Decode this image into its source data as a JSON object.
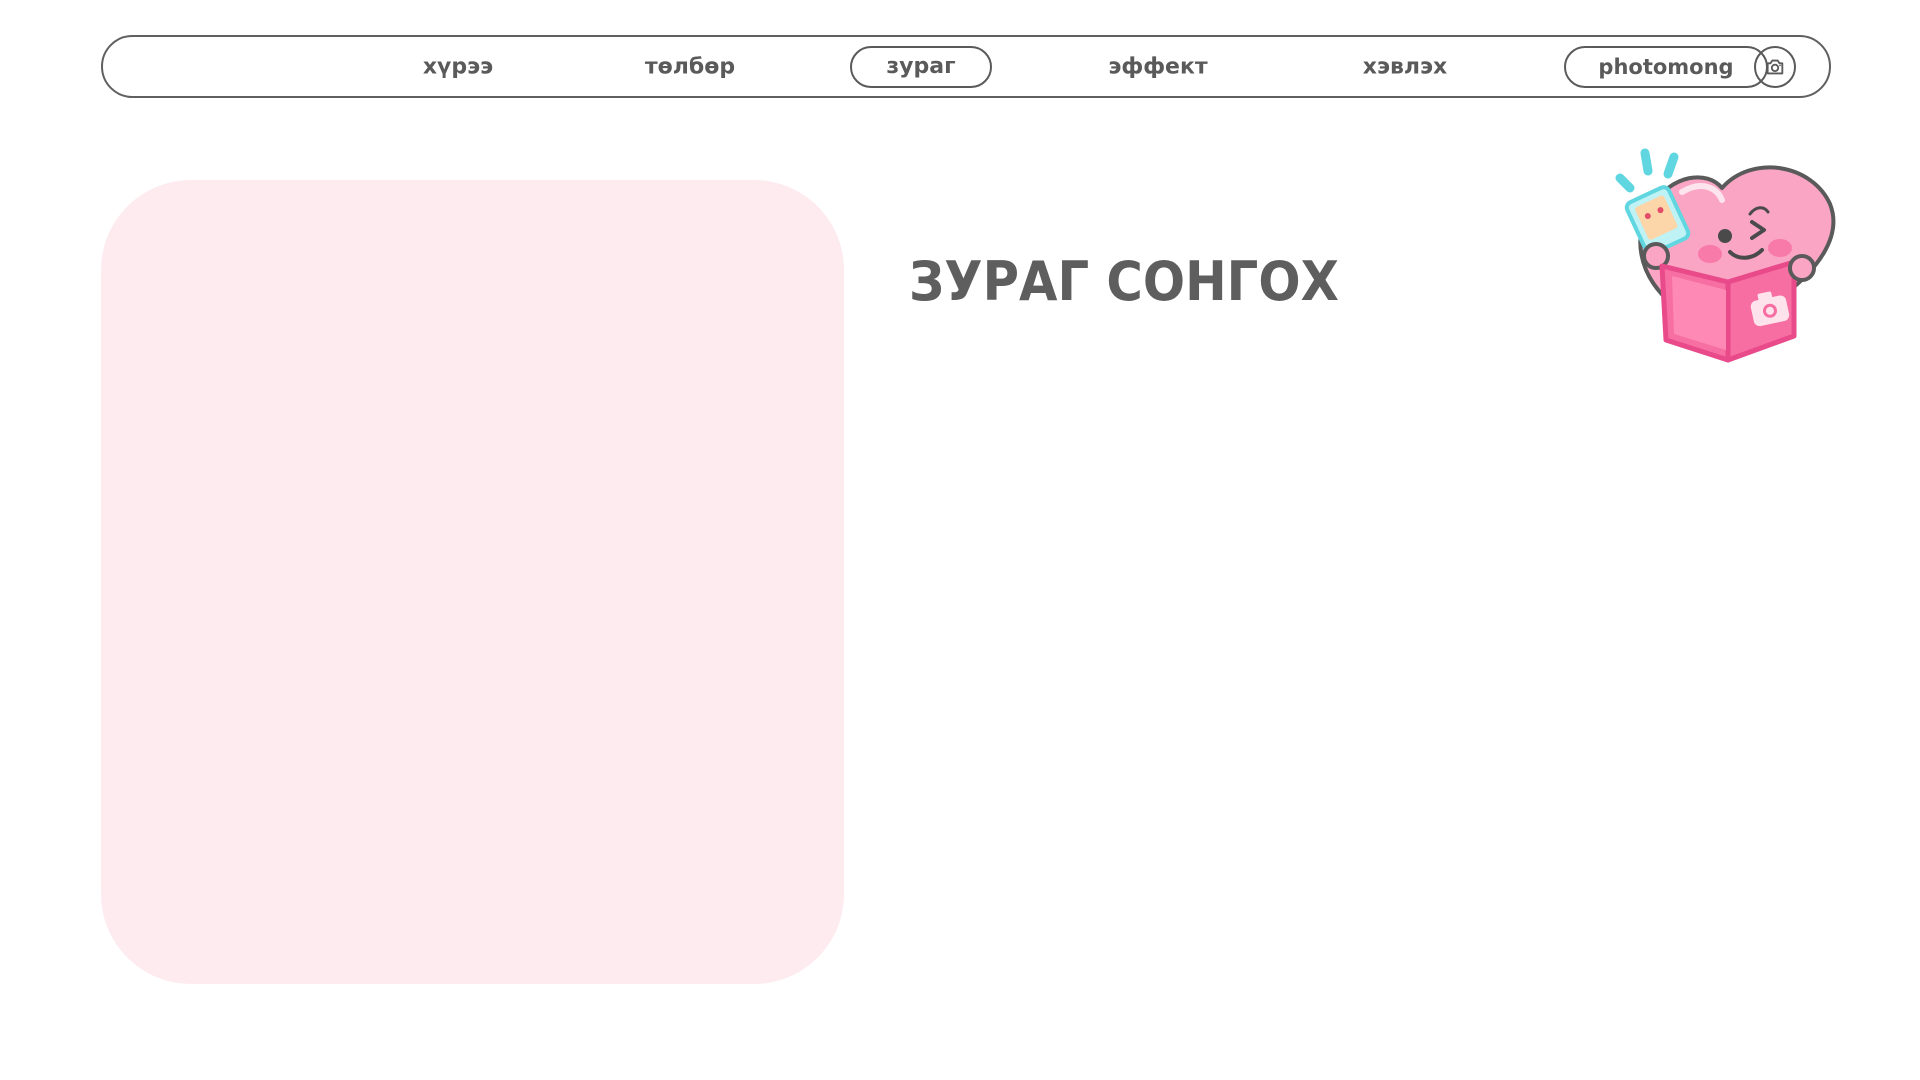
{
  "nav": {
    "items": [
      {
        "label": "хүрээ"
      },
      {
        "label": "төлбөр"
      },
      {
        "label": "зураг",
        "active": true
      },
      {
        "label": "эффект"
      },
      {
        "label": "хэвлэх"
      }
    ],
    "brand": "photomong",
    "camera_icon": "camera-icon"
  },
  "main": {
    "title": "ЗУРАГ СОНГОХ",
    "photo_panel_color": "#fdebf0",
    "mascot_icon": "heart-mascot-icon"
  },
  "colors": {
    "text": "#5a5a5a",
    "border": "#606060",
    "accent_pink": "#f76fa2",
    "panel_pink": "#fdebf0"
  }
}
